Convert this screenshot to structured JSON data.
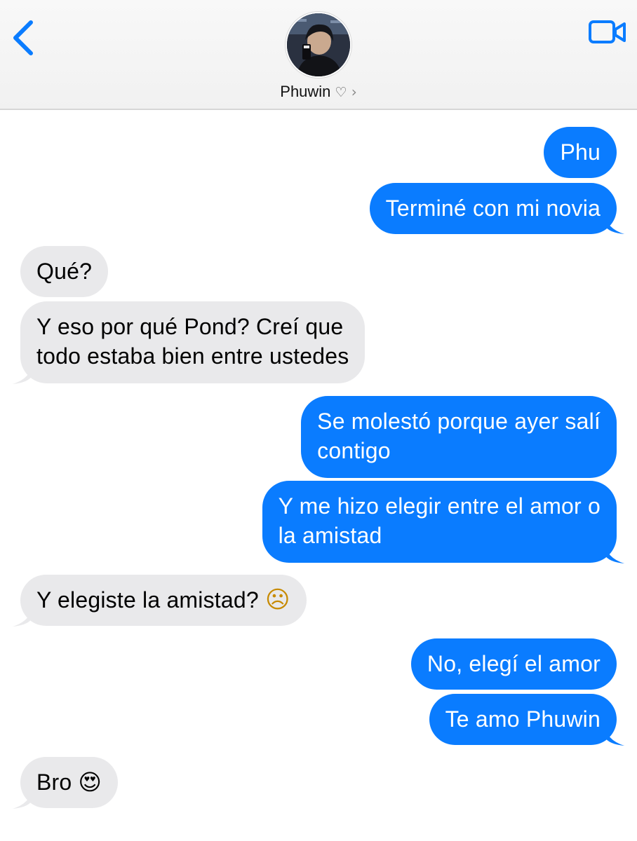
{
  "header": {
    "contact_name": "Phuwin",
    "name_heart": "♡",
    "chevron": "›",
    "back_icon": "chevron-left-icon",
    "video_icon": "video-camera-icon",
    "accent_color": "#0a7cff"
  },
  "messages": [
    {
      "from": "me",
      "text": "Phu"
    },
    {
      "from": "me",
      "text": "Terminé con mi novia"
    },
    {
      "from": "them",
      "text": "Qué?"
    },
    {
      "from": "them",
      "line1": "Y eso por qué Pond? Creí que",
      "line2": "todo estaba bien entre ustedes"
    },
    {
      "from": "me",
      "line1": "Se molestó porque ayer salí",
      "line2": "contigo"
    },
    {
      "from": "me",
      "line1": "Y me hizo elegir entre el amor o",
      "line2": "la amistad"
    },
    {
      "from": "them",
      "text": "Y elegiste la amistad?",
      "emoji": "☹"
    },
    {
      "from": "me",
      "text": "No, elegí el amor"
    },
    {
      "from": "me",
      "text": "Te amo Phuwin"
    },
    {
      "from": "them",
      "text": "Bro",
      "emoji": "😍"
    }
  ],
  "colors": {
    "sent_bubble": "#0a7cff",
    "received_bubble": "#e9e9eb"
  }
}
